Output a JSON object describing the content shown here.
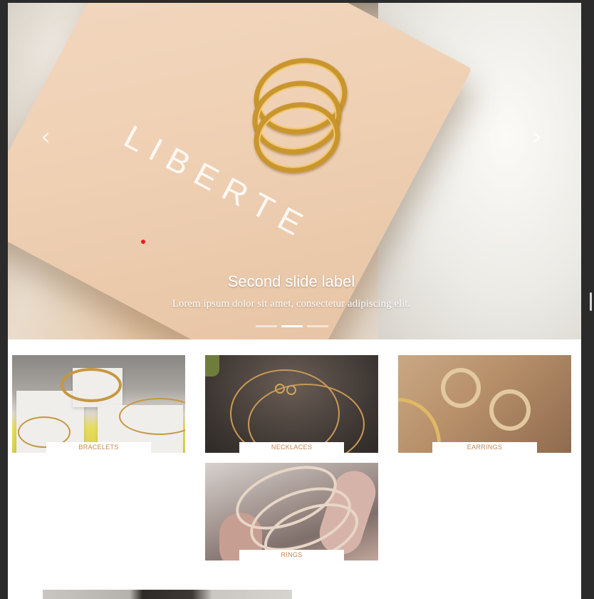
{
  "carousel": {
    "brand_text": "LIBERTE",
    "caption_title": "Second slide label",
    "caption_text": "Lorem ipsum dolor sit amet, consectetur adipiscing elit.",
    "prev_icon": "‹",
    "next_icon": "›",
    "indicator_count": 3,
    "active_indicator": 2
  },
  "categories": [
    {
      "label": "BRACELETS"
    },
    {
      "label": "NECKLACES"
    },
    {
      "label": "EARRINGS"
    },
    {
      "label": "RINGS"
    }
  ],
  "colors": {
    "label_text": "#c8844d",
    "accent_dot": "#e02020"
  }
}
